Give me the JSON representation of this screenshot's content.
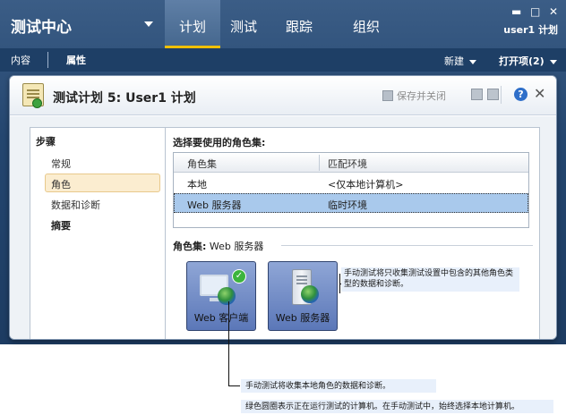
{
  "app": {
    "title": "测试中心",
    "main_tabs": [
      {
        "label": "计划",
        "active": true
      },
      {
        "label": "测试",
        "active": false
      },
      {
        "label": "跟踪",
        "active": false
      },
      {
        "label": "组织",
        "active": false
      }
    ],
    "window_controls": {
      "minimize": "▬",
      "restore": "□",
      "close": "✕"
    },
    "user_label": "user1 计划",
    "colors": {
      "header_bg": "#24466f",
      "active_tab_underline": "#f0c000",
      "selection_bg": "#a9c9ec"
    }
  },
  "subbar": {
    "tabs": [
      {
        "label": "内容",
        "active": false
      },
      {
        "label": "属性",
        "active": true
      }
    ],
    "new_label": "新建",
    "open_items_label": "打开项(2)"
  },
  "panel": {
    "title": "测试计划 5: User1 计划",
    "save_close_label": "保存并关闭",
    "help_label": "?",
    "close_label": "✕"
  },
  "steps": {
    "heading": "步骤",
    "items": [
      {
        "label": "常规",
        "selected": false,
        "bold": false
      },
      {
        "label": "角色",
        "selected": true,
        "bold": false
      },
      {
        "label": "数据和诊断",
        "selected": false,
        "bold": false
      },
      {
        "label": "摘要",
        "selected": false,
        "bold": true
      }
    ]
  },
  "roles": {
    "select_label": "选择要使用的角色集:",
    "columns": [
      "角色集",
      "匹配环境"
    ],
    "rows": [
      {
        "name": "本地",
        "env": "<仅本地计算机>",
        "selected": false
      },
      {
        "name": "Web 服务器",
        "env": "临时环境",
        "selected": true
      }
    ],
    "roleset_prefix": "角色集:",
    "roleset_value": "Web 服务器",
    "cards": [
      {
        "label": "Web 客户端",
        "icon": "web-client-icon",
        "has_check": true
      },
      {
        "label": "Web 服务器",
        "icon": "web-server-icon",
        "has_check": false
      }
    ]
  },
  "callouts": {
    "server_note": "手动测试将只收集测试设置中包含的其他角色类型的数据和诊断。",
    "client_note": "手动测试将收集本地角色的数据和诊断。",
    "green_note": "绿色圆圈表示正在运行测试的计算机。在手动测试中，始终选择本地计算机。"
  }
}
